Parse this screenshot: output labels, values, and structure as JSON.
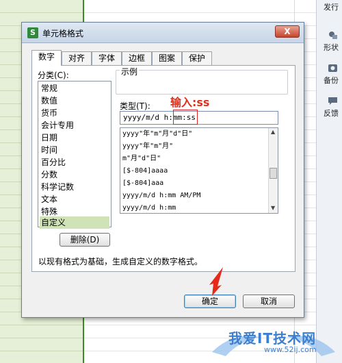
{
  "sidebar_tools": [
    {
      "icon": "send-icon",
      "label": "发行"
    },
    {
      "icon": "shape-icon",
      "label": "形状"
    },
    {
      "icon": "backup-icon",
      "label": "备份"
    },
    {
      "icon": "feedback-icon",
      "label": "反馈"
    }
  ],
  "dialog": {
    "title": "单元格格式",
    "close_label": "X",
    "tabs": [
      "数字",
      "对齐",
      "字体",
      "边框",
      "图案",
      "保护"
    ],
    "active_tab": "数字",
    "category_label": "分类(C):",
    "categories": [
      "常规",
      "数值",
      "货币",
      "会计专用",
      "日期",
      "时间",
      "百分比",
      "分数",
      "科学记数",
      "文本",
      "特殊",
      "自定义"
    ],
    "selected_category": "自定义",
    "example_label": "示例",
    "type_label": "类型(T):",
    "type_value": "yyyy/m/d h:mm:ss",
    "annotation": "输入:ss",
    "format_list": [
      "yyyy\"年\"m\"月\"d\"日\"",
      "yyyy\"年\"m\"月\"",
      "m\"月\"d\"日\"",
      "[$-804]aaaa",
      "[$-804]aaa",
      "yyyy/m/d h:mm AM/PM",
      "yyyy/m/d h:mm"
    ],
    "delete_label": "删除(D)",
    "description": "以现有格式为基础，生成自定义的数字格式。",
    "ok_label": "确定",
    "cancel_label": "取消"
  },
  "watermark": {
    "text": "我爱IT技术网",
    "url": "www.52ij.com"
  }
}
